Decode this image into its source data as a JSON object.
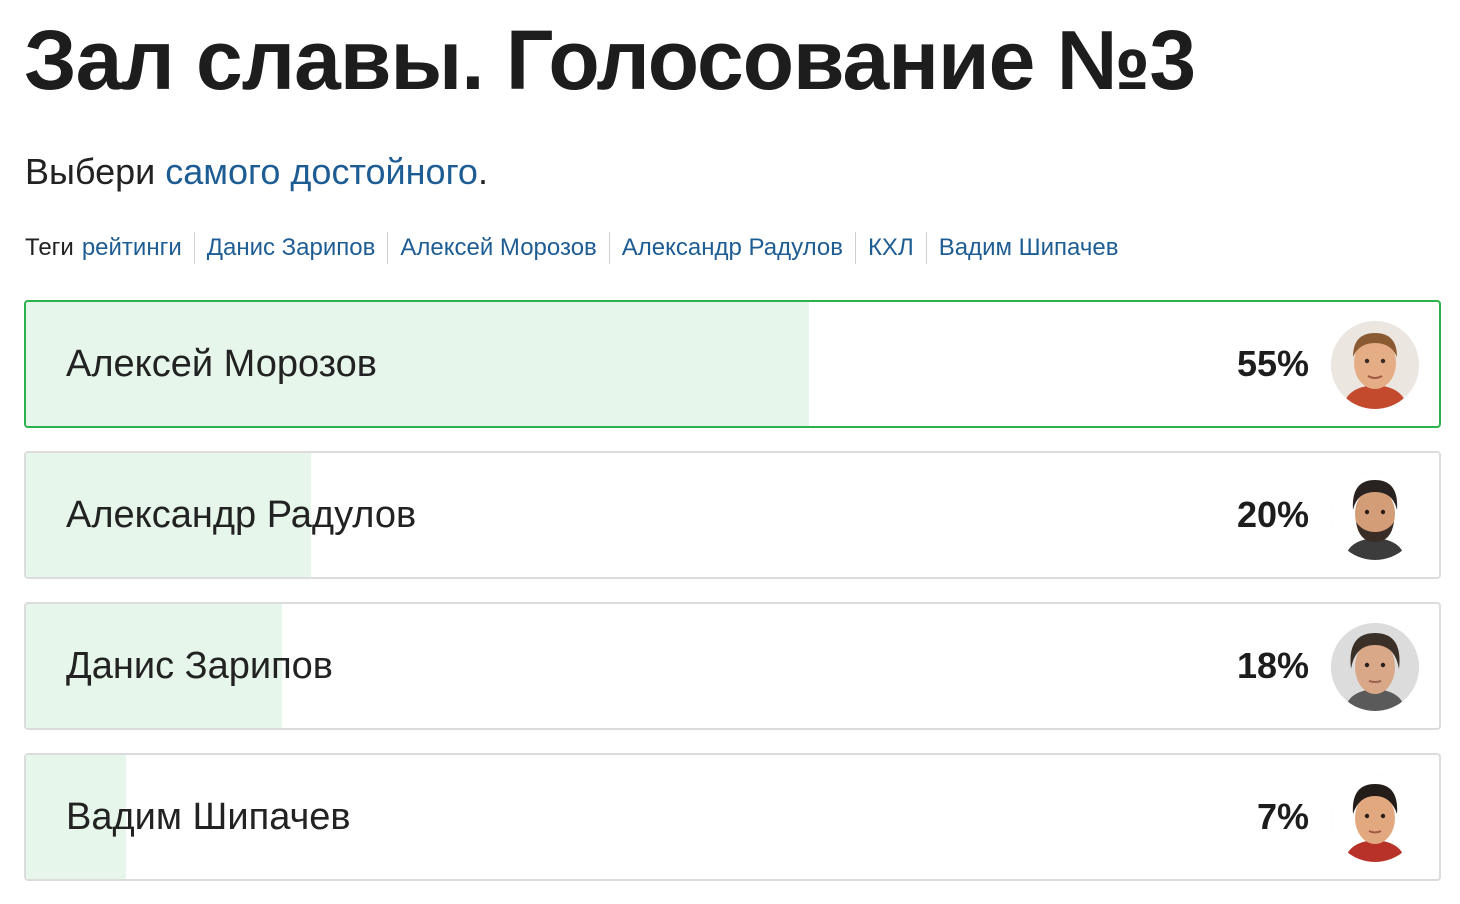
{
  "title": "Зал славы. Голосование №3",
  "lead": {
    "prefix": "Выбери ",
    "link": "самого достойного",
    "suffix": "."
  },
  "tags": {
    "label": "Теги",
    "items": [
      "рейтинги",
      "Данис Зарипов",
      "Алексей Морозов",
      "Александр Радулов",
      "КХЛ",
      "Вадим Шипачев"
    ]
  },
  "poll": {
    "options": [
      {
        "name": "Алексей Морозов",
        "percent_label": "55%",
        "percent": 55
      },
      {
        "name": "Александр Радулов",
        "percent_label": "20%",
        "percent": 20
      },
      {
        "name": "Данис Зарипов",
        "percent_label": "18%",
        "percent": 18
      },
      {
        "name": "Вадим Шипачев",
        "percent_label": "7%",
        "percent": 7
      }
    ]
  },
  "colors": {
    "link": "#1e5d94",
    "bar_fill": "#e6f6ea",
    "leader_border": "#2bb24c"
  }
}
